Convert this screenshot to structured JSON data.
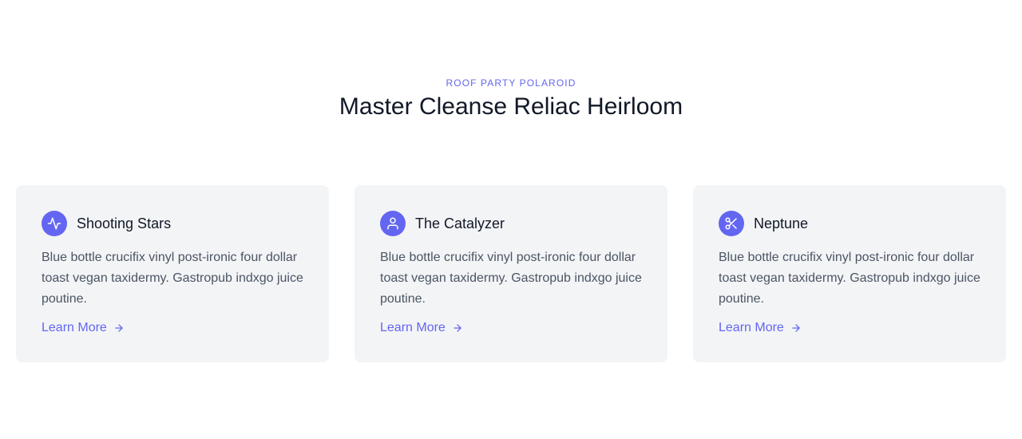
{
  "section": {
    "eyebrow": "ROOF PARTY POLAROID",
    "heading": "Master Cleanse Reliac Heirloom"
  },
  "cards": [
    {
      "title": "Shooting Stars",
      "icon": "activity-icon",
      "body": "Blue bottle crucifix vinyl post-ironic four dollar toast vegan taxidermy. Gastropub indxgo juice poutine.",
      "link": "Learn More"
    },
    {
      "title": "The Catalyzer",
      "icon": "user-icon",
      "body": "Blue bottle crucifix vinyl post-ironic four dollar toast vegan taxidermy. Gastropub indxgo juice poutine.",
      "link": "Learn More"
    },
    {
      "title": "Neptune",
      "icon": "scissors-icon",
      "body": "Blue bottle crucifix vinyl post-ironic four dollar toast vegan taxidermy. Gastropub indxgo juice poutine.",
      "link": "Learn More"
    }
  ],
  "colors": {
    "accent": "#6366f1",
    "card_bg": "#f3f4f6",
    "heading": "#111827",
    "body": "#4b5563"
  }
}
